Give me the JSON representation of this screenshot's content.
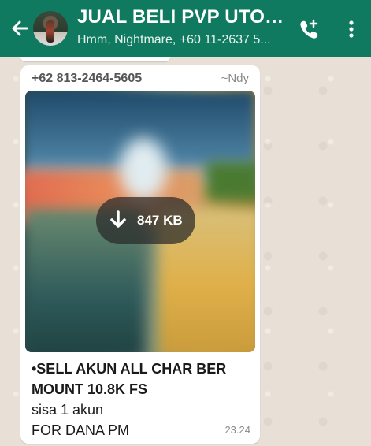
{
  "header": {
    "title": "JUAL BELI PVP UTOPI...",
    "subtitle": "Hmm, Nightmare, +60 11-2637 5...",
    "color": "#0f7a5f"
  },
  "message": {
    "sender": "+62 813-2464-5605",
    "alias": "~Ndy",
    "media": {
      "download_size": "847 KB"
    },
    "caption_lines_bold": [
      "•SELL AKUN ALL CHAR BER",
      "MOUNT 10.8K FS"
    ],
    "caption_lines_plain": [
      "sisa 1 akun",
      "FOR DANA PM"
    ],
    "time": "23.24"
  },
  "icons": [
    "back-arrow-icon",
    "group-avatar-icon",
    "add-call-icon",
    "more-options-icon",
    "download-icon"
  ]
}
